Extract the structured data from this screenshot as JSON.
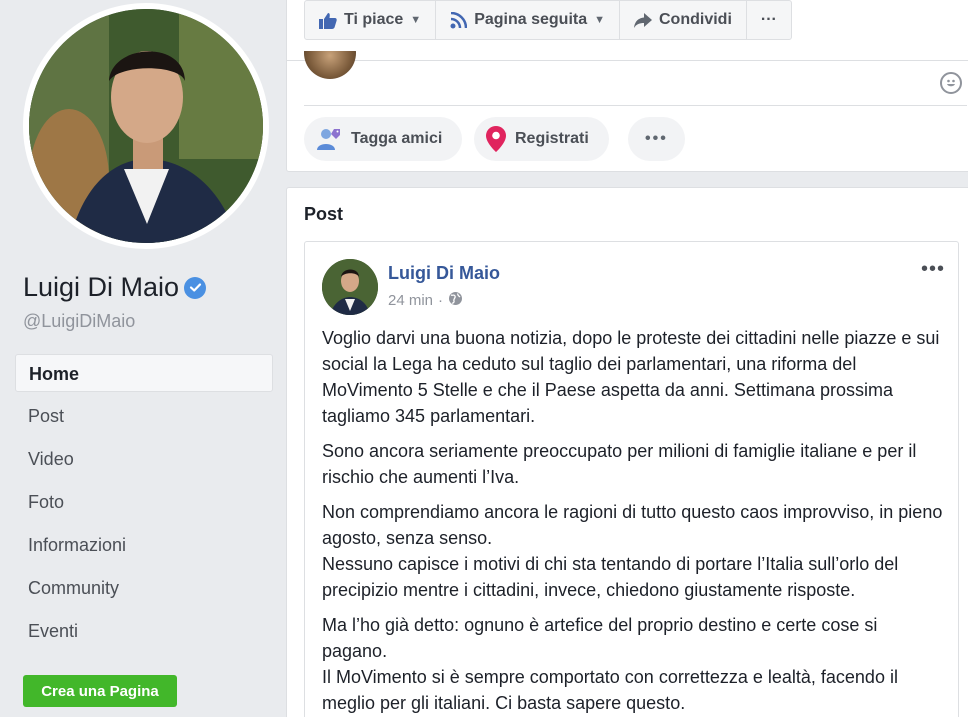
{
  "profile": {
    "name": "Luigi Di Maio",
    "handle": "@LuigiDiMaio"
  },
  "nav": {
    "items": [
      {
        "label": "Home"
      },
      {
        "label": "Post"
      },
      {
        "label": "Video"
      },
      {
        "label": "Foto"
      },
      {
        "label": "Informazioni"
      },
      {
        "label": "Community"
      },
      {
        "label": "Eventi"
      }
    ],
    "create_page": "Crea una Pagina"
  },
  "actions": {
    "like": "Ti piace",
    "follow": "Pagina seguita",
    "share": "Condividi",
    "more": "···"
  },
  "composer": {
    "tag_friends": "Tagga amici",
    "checkin": "Registrati",
    "more": "•••"
  },
  "posts_section": {
    "title": "Post",
    "post": {
      "author": "Luigi Di Maio",
      "time": "24 min",
      "separator": "·",
      "more": "•••",
      "paragraphs": [
        "Voglio darvi una buona notizia, dopo le proteste dei cittadini nelle piazze e sui social la Lega ha ceduto sul taglio dei parlamentari, una riforma del MoVimento 5 Stelle e che il Paese aspetta da anni. Settimana prossima tagliamo 345 parlamentari.",
        "Sono ancora seriamente preoccupato per milioni di famiglie italiane e per il rischio che aumenti l’Iva.",
        "Non comprendiamo ancora le ragioni di tutto questo caos improvviso, in pieno agosto, senza senso.\nNessuno capisce i motivi di chi sta tentando di portare l’Italia sull’orlo del precipizio mentre i cittadini, invece, chiedono giustamente risposte.",
        "Ma l’ho già detto: ognuno è artefice del proprio destino e certe cose si pagano.\nIl MoVimento si è sempre comportato con correttezza e lealtà, facendo il meglio per gli italiani. Ci basta sapere questo."
      ]
    }
  },
  "colors": {
    "link": "#365899",
    "verified": "#4a90e2",
    "create_button": "#42b72a",
    "checkin_pin": "#e0245e"
  },
  "icons": [
    "thumbs-up-icon",
    "rss-icon",
    "share-icon",
    "tag-friends-icon",
    "location-pin-icon",
    "globe-icon",
    "verified-check-icon",
    "emoji-icon"
  ]
}
